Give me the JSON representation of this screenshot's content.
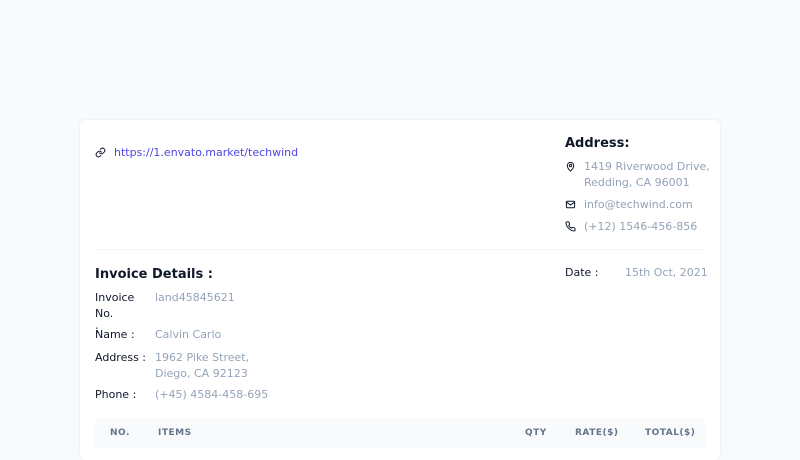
{
  "header": {
    "link_text": "https://1.envato.market/techwind"
  },
  "address": {
    "title": "Address:",
    "street_line1": "1419 Riverwood Drive,",
    "street_line2": "Redding, CA 96001",
    "email": "info@techwind.com",
    "phone": "(+12) 1546-456-856"
  },
  "invoice": {
    "title": "Invoice Details :",
    "number_label_1": "Invoice No.",
    "number_label_2": ":",
    "number_value": "land45845621",
    "name_label": "Name :",
    "name_value": "Calvin Carlo",
    "address_label": "Address :",
    "address_line1": "1962 Pike Street,",
    "address_line2": "Diego, CA 92123",
    "phone_label": "Phone :",
    "phone_value": "(+45) 4584-458-695",
    "date_label": "Date :",
    "date_value": "15th Oct, 2021"
  },
  "table": {
    "columns": [
      "NO.",
      "ITEMS",
      "QTY",
      "RATE($)",
      "TOTAL($)"
    ]
  },
  "colors": {
    "link": "#4f46e5",
    "muted": "#94a3b8",
    "page_bg": "#f8fafc"
  }
}
